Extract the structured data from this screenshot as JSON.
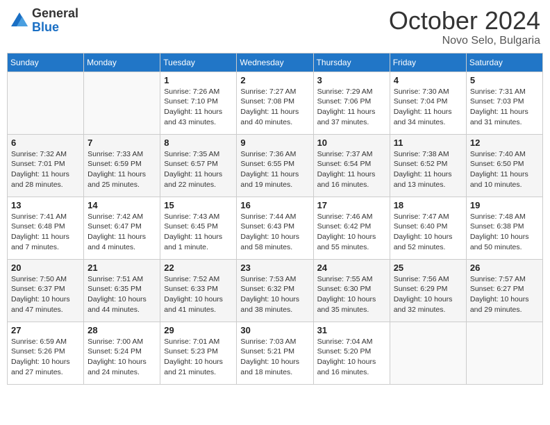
{
  "header": {
    "logo_general": "General",
    "logo_blue": "Blue",
    "month_title": "October 2024",
    "location": "Novo Selo, Bulgaria"
  },
  "calendar": {
    "days_of_week": [
      "Sunday",
      "Monday",
      "Tuesday",
      "Wednesday",
      "Thursday",
      "Friday",
      "Saturday"
    ],
    "weeks": [
      [
        {
          "day": "",
          "info": ""
        },
        {
          "day": "",
          "info": ""
        },
        {
          "day": "1",
          "info": "Sunrise: 7:26 AM\nSunset: 7:10 PM\nDaylight: 11 hours and 43 minutes."
        },
        {
          "day": "2",
          "info": "Sunrise: 7:27 AM\nSunset: 7:08 PM\nDaylight: 11 hours and 40 minutes."
        },
        {
          "day": "3",
          "info": "Sunrise: 7:29 AM\nSunset: 7:06 PM\nDaylight: 11 hours and 37 minutes."
        },
        {
          "day": "4",
          "info": "Sunrise: 7:30 AM\nSunset: 7:04 PM\nDaylight: 11 hours and 34 minutes."
        },
        {
          "day": "5",
          "info": "Sunrise: 7:31 AM\nSunset: 7:03 PM\nDaylight: 11 hours and 31 minutes."
        }
      ],
      [
        {
          "day": "6",
          "info": "Sunrise: 7:32 AM\nSunset: 7:01 PM\nDaylight: 11 hours and 28 minutes."
        },
        {
          "day": "7",
          "info": "Sunrise: 7:33 AM\nSunset: 6:59 PM\nDaylight: 11 hours and 25 minutes."
        },
        {
          "day": "8",
          "info": "Sunrise: 7:35 AM\nSunset: 6:57 PM\nDaylight: 11 hours and 22 minutes."
        },
        {
          "day": "9",
          "info": "Sunrise: 7:36 AM\nSunset: 6:55 PM\nDaylight: 11 hours and 19 minutes."
        },
        {
          "day": "10",
          "info": "Sunrise: 7:37 AM\nSunset: 6:54 PM\nDaylight: 11 hours and 16 minutes."
        },
        {
          "day": "11",
          "info": "Sunrise: 7:38 AM\nSunset: 6:52 PM\nDaylight: 11 hours and 13 minutes."
        },
        {
          "day": "12",
          "info": "Sunrise: 7:40 AM\nSunset: 6:50 PM\nDaylight: 11 hours and 10 minutes."
        }
      ],
      [
        {
          "day": "13",
          "info": "Sunrise: 7:41 AM\nSunset: 6:48 PM\nDaylight: 11 hours and 7 minutes."
        },
        {
          "day": "14",
          "info": "Sunrise: 7:42 AM\nSunset: 6:47 PM\nDaylight: 11 hours and 4 minutes."
        },
        {
          "day": "15",
          "info": "Sunrise: 7:43 AM\nSunset: 6:45 PM\nDaylight: 11 hours and 1 minute."
        },
        {
          "day": "16",
          "info": "Sunrise: 7:44 AM\nSunset: 6:43 PM\nDaylight: 10 hours and 58 minutes."
        },
        {
          "day": "17",
          "info": "Sunrise: 7:46 AM\nSunset: 6:42 PM\nDaylight: 10 hours and 55 minutes."
        },
        {
          "day": "18",
          "info": "Sunrise: 7:47 AM\nSunset: 6:40 PM\nDaylight: 10 hours and 52 minutes."
        },
        {
          "day": "19",
          "info": "Sunrise: 7:48 AM\nSunset: 6:38 PM\nDaylight: 10 hours and 50 minutes."
        }
      ],
      [
        {
          "day": "20",
          "info": "Sunrise: 7:50 AM\nSunset: 6:37 PM\nDaylight: 10 hours and 47 minutes."
        },
        {
          "day": "21",
          "info": "Sunrise: 7:51 AM\nSunset: 6:35 PM\nDaylight: 10 hours and 44 minutes."
        },
        {
          "day": "22",
          "info": "Sunrise: 7:52 AM\nSunset: 6:33 PM\nDaylight: 10 hours and 41 minutes."
        },
        {
          "day": "23",
          "info": "Sunrise: 7:53 AM\nSunset: 6:32 PM\nDaylight: 10 hours and 38 minutes."
        },
        {
          "day": "24",
          "info": "Sunrise: 7:55 AM\nSunset: 6:30 PM\nDaylight: 10 hours and 35 minutes."
        },
        {
          "day": "25",
          "info": "Sunrise: 7:56 AM\nSunset: 6:29 PM\nDaylight: 10 hours and 32 minutes."
        },
        {
          "day": "26",
          "info": "Sunrise: 7:57 AM\nSunset: 6:27 PM\nDaylight: 10 hours and 29 minutes."
        }
      ],
      [
        {
          "day": "27",
          "info": "Sunrise: 6:59 AM\nSunset: 5:26 PM\nDaylight: 10 hours and 27 minutes."
        },
        {
          "day": "28",
          "info": "Sunrise: 7:00 AM\nSunset: 5:24 PM\nDaylight: 10 hours and 24 minutes."
        },
        {
          "day": "29",
          "info": "Sunrise: 7:01 AM\nSunset: 5:23 PM\nDaylight: 10 hours and 21 minutes."
        },
        {
          "day": "30",
          "info": "Sunrise: 7:03 AM\nSunset: 5:21 PM\nDaylight: 10 hours and 18 minutes."
        },
        {
          "day": "31",
          "info": "Sunrise: 7:04 AM\nSunset: 5:20 PM\nDaylight: 10 hours and 16 minutes."
        },
        {
          "day": "",
          "info": ""
        },
        {
          "day": "",
          "info": ""
        }
      ]
    ]
  }
}
